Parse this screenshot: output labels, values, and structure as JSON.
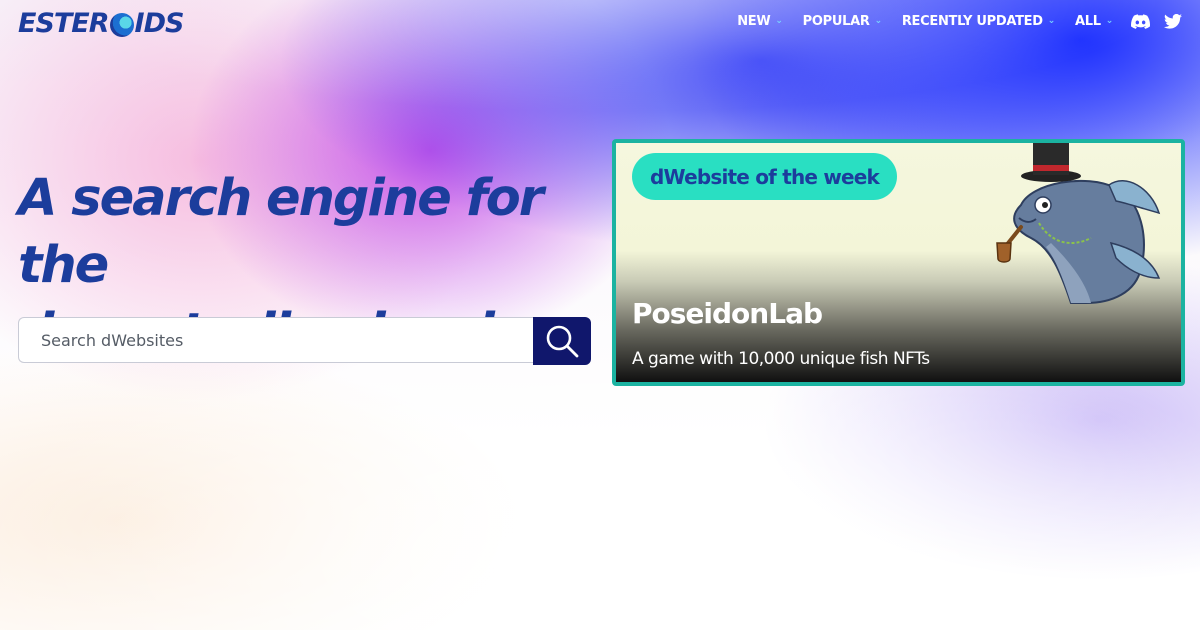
{
  "header": {
    "logo_text_1": "ESTER",
    "logo_text_2": "IDS",
    "nav": [
      {
        "label": "NEW"
      },
      {
        "label": "POPULAR"
      },
      {
        "label": "RECENTLY UPDATED"
      },
      {
        "label": "ALL"
      }
    ],
    "social_icons": [
      "discord-icon",
      "twitter-icon"
    ]
  },
  "hero": {
    "headline_line1": "A search engine for the",
    "headline_line2": "decentralized web",
    "search_placeholder": "Search dWebsites"
  },
  "featured": {
    "badge": "dWebsite of the week",
    "title": "PoseidonLab",
    "description": "A game with 10,000 unique fish NFTs"
  },
  "colors": {
    "brand_blue": "#1c3d9c",
    "search_button": "#10176c",
    "card_border": "#1bb3a1",
    "badge_bg": "#29dfc2",
    "nav_chevron": "#79d7ff"
  }
}
